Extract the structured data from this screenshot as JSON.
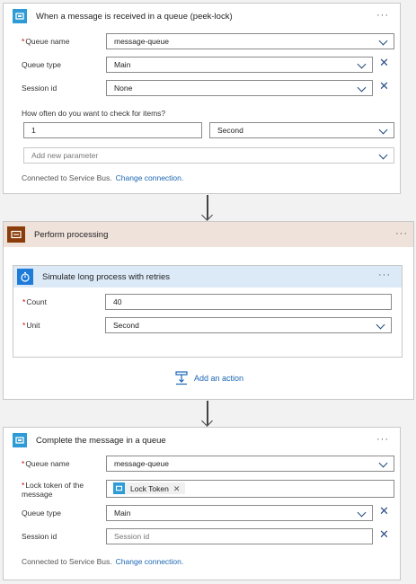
{
  "trigger": {
    "title": "When a message is received in a queue (peek-lock)",
    "queue_name_label": "Queue name",
    "queue_name_value": "message-queue",
    "queue_type_label": "Queue type",
    "queue_type_value": "Main",
    "session_id_label": "Session id",
    "session_id_value": "None",
    "interval_label": "How often do you want to check for items?",
    "interval_value": "1",
    "interval_unit": "Second",
    "add_param_placeholder": "Add new parameter",
    "connection_text": "Connected to Service Bus.",
    "change_connection": "Change connection."
  },
  "scope": {
    "title": "Perform processing",
    "inner": {
      "title": "Simulate long process with retries",
      "count_label": "Count",
      "count_value": "40",
      "unit_label": "Unit",
      "unit_value": "Second"
    },
    "add_action": "Add an action"
  },
  "complete": {
    "title": "Complete the message in a queue",
    "queue_name_label": "Queue name",
    "queue_name_value": "message-queue",
    "lock_token_label_1": "Lock token of the",
    "lock_token_label_2": "message",
    "lock_token_chip": "Lock Token",
    "queue_type_label": "Queue type",
    "queue_type_value": "Main",
    "session_id_label": "Session id",
    "session_id_placeholder": "Session id",
    "connection_text": "Connected to Service Bus.",
    "change_connection": "Change connection."
  },
  "icons": {
    "service_bus": "service-bus-icon",
    "scope": "scope-icon",
    "delay": "stopwatch-icon",
    "add_action": "add-action-icon",
    "more": "more-options-icon",
    "remove": "close-icon",
    "dropdown": "chevron-down-icon",
    "arrow": "arrow-down-icon"
  },
  "colors": {
    "service_bus_blue": "#2e9bd6",
    "scope_brown": "#8a3c0a",
    "scope_header_bg": "#efe2db",
    "delay_header_bg": "#dceaf8",
    "delay_blue": "#1f7bd8",
    "link_blue": "#1b66b3",
    "required_red": "#cc0000"
  }
}
